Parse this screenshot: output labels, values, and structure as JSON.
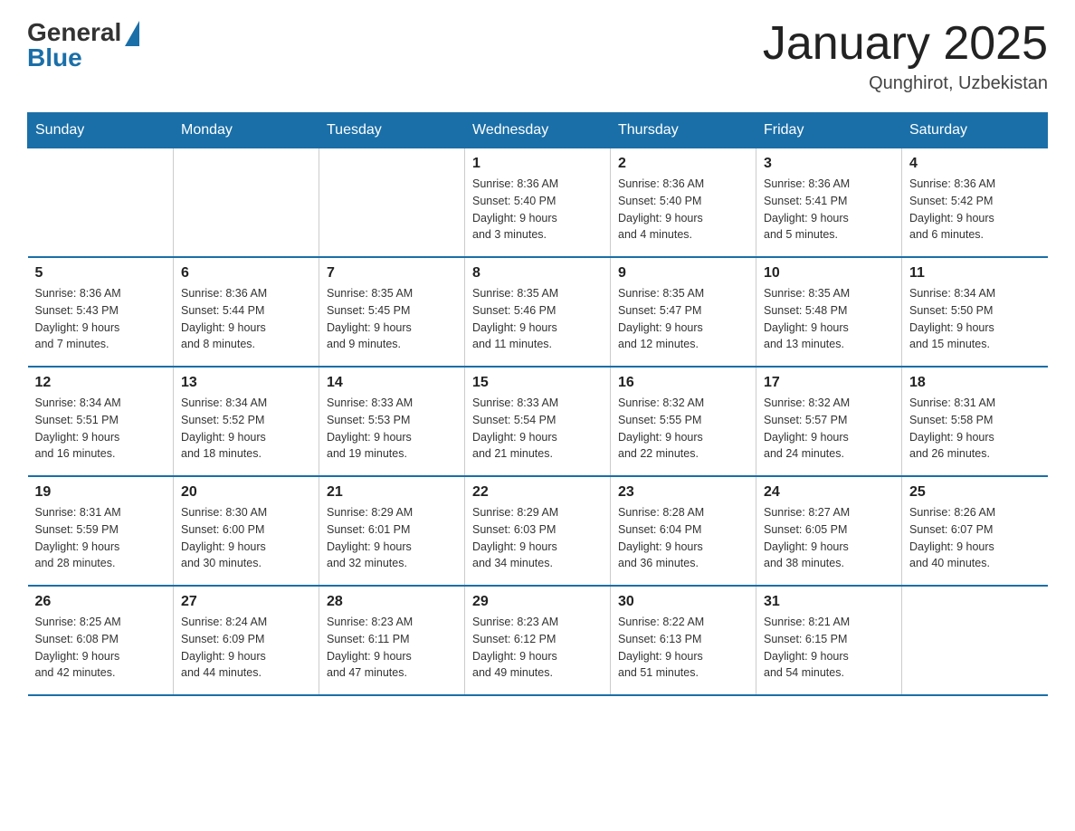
{
  "header": {
    "logo_general": "General",
    "logo_blue": "Blue",
    "month_title": "January 2025",
    "location": "Qunghirot, Uzbekistan"
  },
  "weekdays": [
    "Sunday",
    "Monday",
    "Tuesday",
    "Wednesday",
    "Thursday",
    "Friday",
    "Saturday"
  ],
  "weeks": [
    [
      {
        "day": "",
        "info": ""
      },
      {
        "day": "",
        "info": ""
      },
      {
        "day": "",
        "info": ""
      },
      {
        "day": "1",
        "info": "Sunrise: 8:36 AM\nSunset: 5:40 PM\nDaylight: 9 hours\nand 3 minutes."
      },
      {
        "day": "2",
        "info": "Sunrise: 8:36 AM\nSunset: 5:40 PM\nDaylight: 9 hours\nand 4 minutes."
      },
      {
        "day": "3",
        "info": "Sunrise: 8:36 AM\nSunset: 5:41 PM\nDaylight: 9 hours\nand 5 minutes."
      },
      {
        "day": "4",
        "info": "Sunrise: 8:36 AM\nSunset: 5:42 PM\nDaylight: 9 hours\nand 6 minutes."
      }
    ],
    [
      {
        "day": "5",
        "info": "Sunrise: 8:36 AM\nSunset: 5:43 PM\nDaylight: 9 hours\nand 7 minutes."
      },
      {
        "day": "6",
        "info": "Sunrise: 8:36 AM\nSunset: 5:44 PM\nDaylight: 9 hours\nand 8 minutes."
      },
      {
        "day": "7",
        "info": "Sunrise: 8:35 AM\nSunset: 5:45 PM\nDaylight: 9 hours\nand 9 minutes."
      },
      {
        "day": "8",
        "info": "Sunrise: 8:35 AM\nSunset: 5:46 PM\nDaylight: 9 hours\nand 11 minutes."
      },
      {
        "day": "9",
        "info": "Sunrise: 8:35 AM\nSunset: 5:47 PM\nDaylight: 9 hours\nand 12 minutes."
      },
      {
        "day": "10",
        "info": "Sunrise: 8:35 AM\nSunset: 5:48 PM\nDaylight: 9 hours\nand 13 minutes."
      },
      {
        "day": "11",
        "info": "Sunrise: 8:34 AM\nSunset: 5:50 PM\nDaylight: 9 hours\nand 15 minutes."
      }
    ],
    [
      {
        "day": "12",
        "info": "Sunrise: 8:34 AM\nSunset: 5:51 PM\nDaylight: 9 hours\nand 16 minutes."
      },
      {
        "day": "13",
        "info": "Sunrise: 8:34 AM\nSunset: 5:52 PM\nDaylight: 9 hours\nand 18 minutes."
      },
      {
        "day": "14",
        "info": "Sunrise: 8:33 AM\nSunset: 5:53 PM\nDaylight: 9 hours\nand 19 minutes."
      },
      {
        "day": "15",
        "info": "Sunrise: 8:33 AM\nSunset: 5:54 PM\nDaylight: 9 hours\nand 21 minutes."
      },
      {
        "day": "16",
        "info": "Sunrise: 8:32 AM\nSunset: 5:55 PM\nDaylight: 9 hours\nand 22 minutes."
      },
      {
        "day": "17",
        "info": "Sunrise: 8:32 AM\nSunset: 5:57 PM\nDaylight: 9 hours\nand 24 minutes."
      },
      {
        "day": "18",
        "info": "Sunrise: 8:31 AM\nSunset: 5:58 PM\nDaylight: 9 hours\nand 26 minutes."
      }
    ],
    [
      {
        "day": "19",
        "info": "Sunrise: 8:31 AM\nSunset: 5:59 PM\nDaylight: 9 hours\nand 28 minutes."
      },
      {
        "day": "20",
        "info": "Sunrise: 8:30 AM\nSunset: 6:00 PM\nDaylight: 9 hours\nand 30 minutes."
      },
      {
        "day": "21",
        "info": "Sunrise: 8:29 AM\nSunset: 6:01 PM\nDaylight: 9 hours\nand 32 minutes."
      },
      {
        "day": "22",
        "info": "Sunrise: 8:29 AM\nSunset: 6:03 PM\nDaylight: 9 hours\nand 34 minutes."
      },
      {
        "day": "23",
        "info": "Sunrise: 8:28 AM\nSunset: 6:04 PM\nDaylight: 9 hours\nand 36 minutes."
      },
      {
        "day": "24",
        "info": "Sunrise: 8:27 AM\nSunset: 6:05 PM\nDaylight: 9 hours\nand 38 minutes."
      },
      {
        "day": "25",
        "info": "Sunrise: 8:26 AM\nSunset: 6:07 PM\nDaylight: 9 hours\nand 40 minutes."
      }
    ],
    [
      {
        "day": "26",
        "info": "Sunrise: 8:25 AM\nSunset: 6:08 PM\nDaylight: 9 hours\nand 42 minutes."
      },
      {
        "day": "27",
        "info": "Sunrise: 8:24 AM\nSunset: 6:09 PM\nDaylight: 9 hours\nand 44 minutes."
      },
      {
        "day": "28",
        "info": "Sunrise: 8:23 AM\nSunset: 6:11 PM\nDaylight: 9 hours\nand 47 minutes."
      },
      {
        "day": "29",
        "info": "Sunrise: 8:23 AM\nSunset: 6:12 PM\nDaylight: 9 hours\nand 49 minutes."
      },
      {
        "day": "30",
        "info": "Sunrise: 8:22 AM\nSunset: 6:13 PM\nDaylight: 9 hours\nand 51 minutes."
      },
      {
        "day": "31",
        "info": "Sunrise: 8:21 AM\nSunset: 6:15 PM\nDaylight: 9 hours\nand 54 minutes."
      },
      {
        "day": "",
        "info": ""
      }
    ]
  ]
}
